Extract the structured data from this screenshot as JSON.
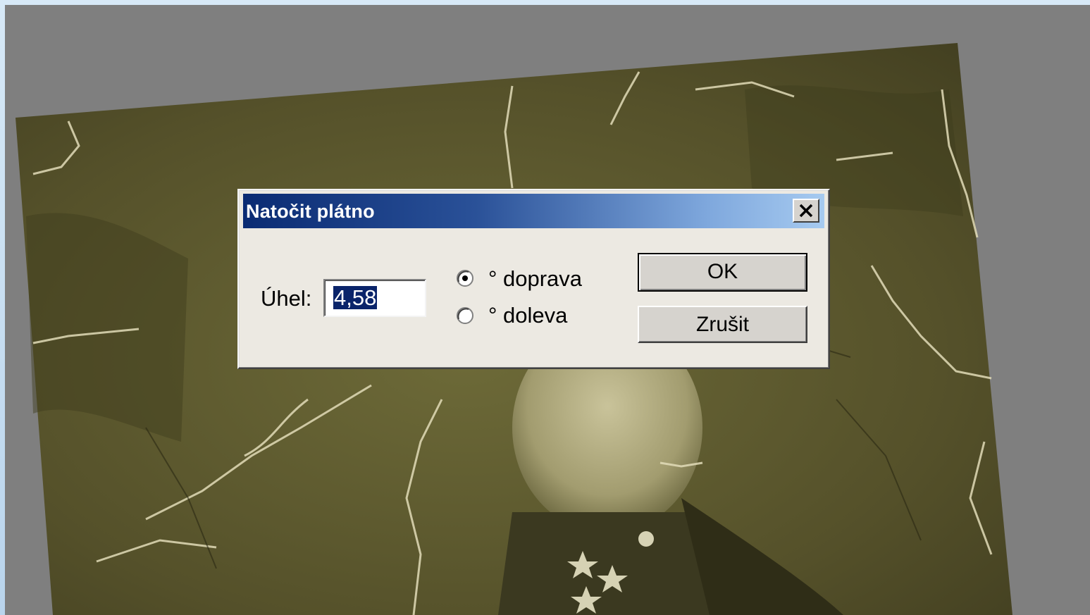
{
  "dialog": {
    "title": "Natočit plátno",
    "angle_label": "Úhel:",
    "angle_value": "4,58",
    "direction_options": [
      {
        "label": "° doprava",
        "selected": true
      },
      {
        "label": "° doleva",
        "selected": false
      }
    ],
    "ok_label": "OK",
    "cancel_label": "Zrušit"
  },
  "colors": {
    "title_bar_start": "#0a2b73",
    "title_bar_end": "#a6caf0",
    "dialog_face": "#ece9e2",
    "workspace_gray": "#7f7f7f",
    "photo_tone": "#5a5529"
  },
  "icons": {
    "close": "close-icon"
  }
}
